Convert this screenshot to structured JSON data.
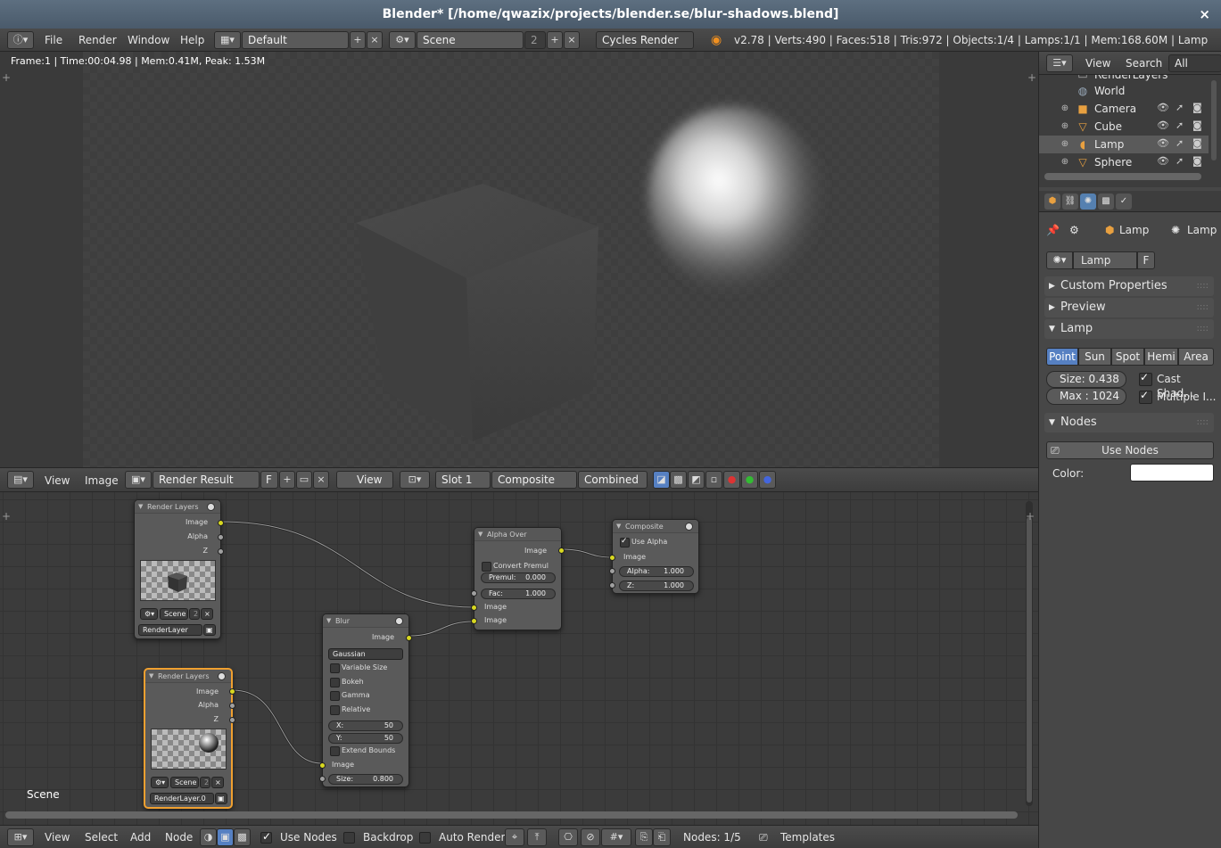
{
  "window": {
    "title": "Blender* [/home/qwazix/projects/blender.se/blur-shadows.blend]",
    "close_glyph": "×"
  },
  "info_header": {
    "menus": [
      "File",
      "Render",
      "Window",
      "Help"
    ],
    "screen_layout": "Default",
    "scene": "Scene",
    "scene_users": "2",
    "render_engine": "Cycles Render",
    "stats": "v2.78 | Verts:490 | Faces:518 | Tris:972 | Objects:1/4 | Lamps:1/1 | Mem:168.60M | Lamp"
  },
  "viewport": {
    "frame_info": "Frame:1 | Time:00:04.98 | Mem:0.41M, Peak: 1.53M"
  },
  "image_header": {
    "menus": [
      "View",
      "Image"
    ],
    "image_name": "Render Result",
    "fake_user": "F",
    "view_menu": "View",
    "slot": "Slot 1",
    "layer": "Composite",
    "pass": "Combined"
  },
  "nodes": {
    "render_layers_1": {
      "title": "Render Layers",
      "outputs": [
        "Image",
        "Alpha",
        "Z"
      ],
      "scene": "Scene",
      "scene_users": "2",
      "layer": "RenderLayer"
    },
    "render_layers_2": {
      "title": "Render Layers",
      "outputs": [
        "Image",
        "Alpha",
        "Z"
      ],
      "scene": "Scene",
      "scene_users": "2",
      "layer": "RenderLayer.0"
    },
    "blur": {
      "title": "Blur",
      "output": "Image",
      "filter": "Gaussian",
      "variable_size": "Variable Size",
      "bokeh": "Bokeh",
      "gamma": "Gamma",
      "relative": "Relative",
      "x_label": "X:",
      "x_value": "50",
      "y_label": "Y:",
      "y_value": "50",
      "extend_bounds": "Extend Bounds",
      "input": "Image",
      "size_label": "Size:",
      "size_value": "0.800"
    },
    "alpha_over": {
      "title": "Alpha Over",
      "output": "Image",
      "convert_premul": "Convert Premul",
      "premul_label": "Premul:",
      "premul_value": "0.000",
      "fac_label": "Fac:",
      "fac_value": "1.000",
      "input1": "Image",
      "input2": "Image"
    },
    "composite": {
      "title": "Composite",
      "use_alpha": "Use Alpha",
      "input": "Image",
      "alpha_label": "Alpha:",
      "alpha_value": "1.000",
      "z_label": "Z:",
      "z_value": "1.000"
    }
  },
  "node_editor": {
    "scene_label": "Scene"
  },
  "node_header": {
    "menus": [
      "View",
      "Select",
      "Add",
      "Node"
    ],
    "use_nodes": "Use Nodes",
    "backdrop": "Backdrop",
    "auto_render": "Auto Render",
    "nodes_count": "Nodes: 1/5",
    "templates": "Templates"
  },
  "outliner": {
    "menus": [
      "View",
      "Search"
    ],
    "filter": "All Scenes",
    "items": [
      {
        "name": "RenderLayers"
      },
      {
        "name": "World"
      },
      {
        "name": "Camera"
      },
      {
        "name": "Cube"
      },
      {
        "name": "Lamp"
      },
      {
        "name": "Sphere"
      }
    ]
  },
  "properties": {
    "breadcrumb_1": "Lamp",
    "breadcrumb_2": "Lamp",
    "datablock": "Lamp",
    "fake_user": "F",
    "sections": {
      "custom_properties": "Custom Properties",
      "preview": "Preview",
      "lamp": "Lamp",
      "nodes": "Nodes"
    },
    "lamp_types": [
      "Point",
      "Sun",
      "Spot",
      "Hemi",
      "Area"
    ],
    "size_label": "Size:",
    "size_value": "0.438",
    "max_label": "Max :",
    "max_value": "1024",
    "cast_shadow": "Cast Shad...",
    "multiple_importance": "Multiple I...",
    "use_nodes": "Use Nodes",
    "color_label": "Color:"
  },
  "colors": {
    "selected_accent": "#5680c2",
    "node_selected_outline": "#f0a030",
    "image_socket": "#d8d820"
  }
}
